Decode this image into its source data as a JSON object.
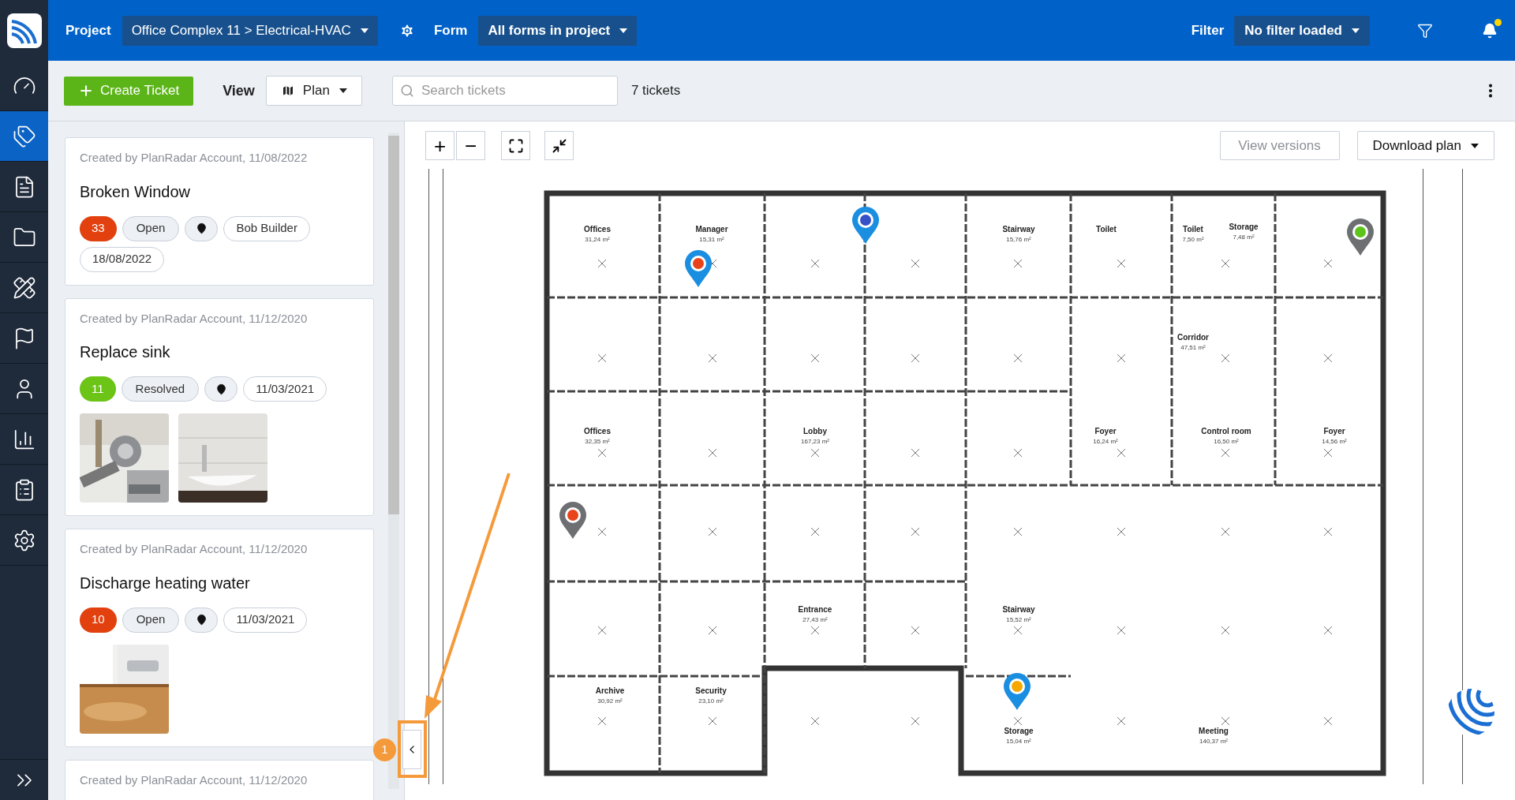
{
  "top_bar": {
    "project_label": "Project",
    "project_value": "Office Complex 11 > Electrical-HVAC",
    "form_label": "Form",
    "form_value": "All forms in project",
    "filter_label": "Filter",
    "filter_value": "No filter loaded",
    "notification_dot": true
  },
  "toolbar": {
    "create_button": "Create Ticket",
    "view_label": "View",
    "view_value": "Plan",
    "search": {
      "placeholder": "Search tickets"
    },
    "count": "7 tickets"
  },
  "nav": [
    {
      "kind": "gauge",
      "selected": false
    },
    {
      "kind": "tags",
      "selected": true
    },
    {
      "kind": "report",
      "selected": false
    },
    {
      "kind": "folder",
      "selected": false
    },
    {
      "kind": "ruler",
      "selected": false
    },
    {
      "kind": "flag",
      "selected": false
    },
    {
      "kind": "user",
      "selected": false
    },
    {
      "kind": "chart",
      "selected": false
    },
    {
      "kind": "clipboard",
      "selected": false
    },
    {
      "kind": "settings",
      "selected": false
    }
  ],
  "tickets": [
    {
      "created": "Created by PlanRadar Account, 11/08/2022",
      "title": "Broken Window",
      "number": "33",
      "color": "#e2400e",
      "status": "Open",
      "chips": [
        {
          "kind": "location"
        },
        {
          "kind": "text",
          "label": "Bob Builder"
        },
        {
          "kind": "text",
          "label": "18/08/2022"
        }
      ]
    },
    {
      "created": "Created by PlanRadar Account, 11/12/2020",
      "title": "Replace sink",
      "number": "11",
      "color": "#6cc417",
      "status": "Resolved",
      "chips": [
        {
          "kind": "location"
        },
        {
          "kind": "text",
          "label": "11/03/2021"
        }
      ],
      "photos": [
        {
          "kind": "picture"
        },
        {
          "kind": "picture"
        }
      ]
    },
    {
      "created": "Created by PlanRadar Account, 11/12/2020",
      "title": "Discharge heating water",
      "number": "10",
      "color": "#e2400e",
      "status": "Open",
      "chips": [
        {
          "kind": "location"
        },
        {
          "kind": "text",
          "label": "11/03/2021"
        }
      ],
      "photos": [
        {
          "kind": "picture"
        }
      ]
    },
    {
      "created": "Created by PlanRadar Account, 11/12/2020"
    }
  ],
  "plan": {
    "zoom_in": "+",
    "zoom_out": "−",
    "view_versions": "View versions",
    "download": "Download plan",
    "rooms": [
      {
        "name": "Offices",
        "area": "31,24 m²"
      },
      {
        "name": "Manager",
        "area": "15,31 m²"
      },
      {
        "name": "Stairway",
        "area": "15,76 m²"
      },
      {
        "name": "Toilet"
      },
      {
        "name": "Toilet",
        "area": "7,50 m²"
      },
      {
        "name": "Storage",
        "area": "7,48 m²"
      },
      {
        "name": "Corridor",
        "area": "47,51 m²"
      },
      {
        "name": "Offices",
        "area": "32,35 m²"
      },
      {
        "name": "Lobby",
        "area": "167,23 m²"
      },
      {
        "name": "Foyer",
        "area": "16,24 m²"
      },
      {
        "name": "Control room",
        "area": "16,50 m²"
      },
      {
        "name": "Foyer",
        "area": "14,56 m²"
      },
      {
        "name": "Entrance",
        "area": "27,43 m²"
      },
      {
        "name": "Stairway",
        "area": "15,52 m²"
      },
      {
        "name": "Archive",
        "area": "30,92 m²"
      },
      {
        "name": "Security",
        "area": "23,10 m²"
      },
      {
        "name": "Storage",
        "area": "15,04 m²"
      },
      {
        "name": "Meeting",
        "area": "140,37 m²"
      }
    ],
    "pins": [
      {
        "kind": "blue",
        "color": "#e8431a"
      },
      {
        "kind": "blue",
        "color": "#3650c8"
      },
      {
        "kind": "grey",
        "color": "#5cc41a"
      },
      {
        "kind": "grey",
        "color": "#e8431a"
      },
      {
        "kind": "blue",
        "color": "#f5a800"
      }
    ]
  },
  "annotation": {
    "badge": "1"
  }
}
